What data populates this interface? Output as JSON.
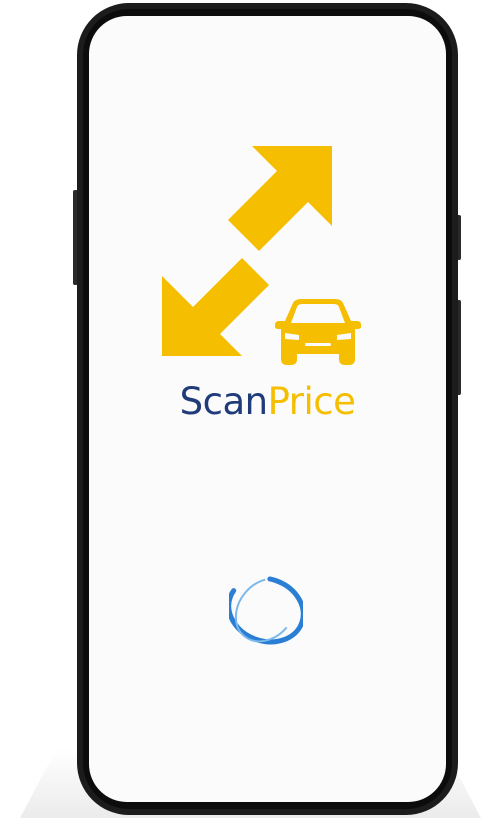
{
  "app": {
    "brand_part1": "Scan",
    "brand_part2": "Price"
  },
  "colors": {
    "brand_primary": "#1f3b7a",
    "brand_accent": "#f5be00",
    "spinner": "#2a7fd4"
  },
  "icons": {
    "logo_arrows": "diagonal-double-arrow-icon",
    "logo_car": "car-icon",
    "loading": "loading-spinner-icon"
  }
}
